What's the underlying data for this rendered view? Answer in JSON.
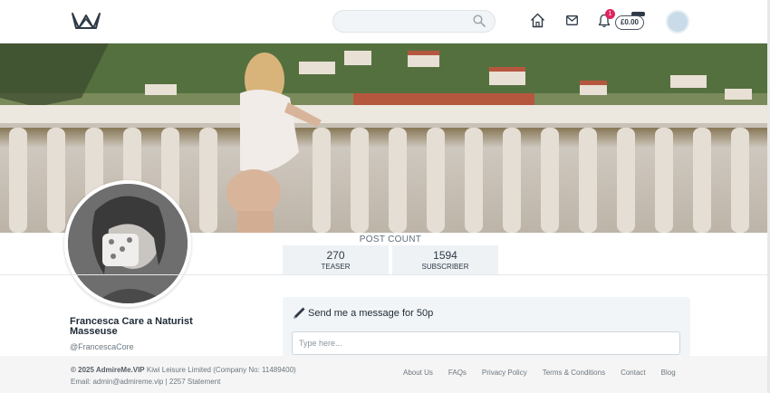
{
  "header": {
    "logo_icon": "crown-icon",
    "search": {
      "placeholder": "",
      "value": "",
      "icon": "search-icon"
    },
    "nav": {
      "home_icon": "home-icon",
      "messages_icon": "mail-icon",
      "notifications_icon": "bell-icon"
    },
    "notification_count": "1",
    "wallet_balance": "£0.00",
    "avatar_icon": "user-avatar-icon"
  },
  "profile": {
    "name": "Francesca Care a Naturist Masseuse",
    "handle": "@FrancescaCore"
  },
  "stats": {
    "label": "POST COUNT",
    "items": [
      {
        "value": "270",
        "label": "TEASER"
      },
      {
        "value": "1594",
        "label": "SUBSCRIBER"
      }
    ]
  },
  "message": {
    "icon": "pen-icon",
    "title": "Send me a message for 50p",
    "placeholder": "Type here..."
  },
  "footer": {
    "copyright_bold": "© 2025 AdmireMe.VIP",
    "copyright_rest": " Kiwi Leisure Limited (Company No: 11489400)",
    "contact": "Email: admin@admireme.vip | 2257 Statement",
    "links": [
      "About Us",
      "FAQs",
      "Privacy Policy",
      "Terms & Conditions",
      "Contact",
      "Blog"
    ]
  },
  "colors": {
    "accent": "#2e3a46",
    "badge": "#e0245e",
    "card_bg": "#f2f5f7",
    "footer_bg": "#f5f5f5"
  }
}
